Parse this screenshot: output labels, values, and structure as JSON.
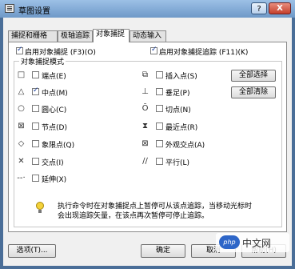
{
  "window": {
    "title": "草图设置",
    "help_label": "?",
    "close_label": "X"
  },
  "tabs": [
    {
      "label": "捕捉和栅格"
    },
    {
      "label": "极轴追踪"
    },
    {
      "label": "对象捕捉"
    },
    {
      "label": "动态输入"
    }
  ],
  "top_options": {
    "enable_snap": {
      "label": "启用对象捕捉 (F3)(O)",
      "checked": true
    },
    "enable_tracking": {
      "label": "启用对象捕捉追踪 (F11)(K)",
      "checked": true
    }
  },
  "group": {
    "title": "对象捕捉模式",
    "select_all": "全部选择",
    "clear_all": "全部清除",
    "left_modes": [
      {
        "label": "端点(E)",
        "checked": false,
        "icon": "square-icon"
      },
      {
        "label": "中点(M)",
        "checked": true,
        "icon": "triangle-icon"
      },
      {
        "label": "圆心(C)",
        "checked": false,
        "icon": "circle-icon"
      },
      {
        "label": "节点(D)",
        "checked": false,
        "icon": "x-box-icon"
      },
      {
        "label": "象限点(Q)",
        "checked": false,
        "icon": "diamond-icon"
      },
      {
        "label": "交点(I)",
        "checked": false,
        "icon": "cross-icon"
      },
      {
        "label": "延伸(X)",
        "checked": false,
        "icon": "extension-icon"
      }
    ],
    "right_modes": [
      {
        "label": "插入点(S)",
        "checked": false,
        "icon": "insert-icon"
      },
      {
        "label": "垂足(P)",
        "checked": false,
        "icon": "perpendicular-icon"
      },
      {
        "label": "切点(N)",
        "checked": false,
        "icon": "tangent-icon"
      },
      {
        "label": "最近点(R)",
        "checked": false,
        "icon": "hourglass-icon"
      },
      {
        "label": "外观交点(A)",
        "checked": false,
        "icon": "apparent-intersection-icon"
      },
      {
        "label": "平行(L)",
        "checked": false,
        "icon": "parallel-icon"
      }
    ],
    "hint_line1": "执行命令时在对象捕捉点上暂停可从该点追踪，当移动光标时",
    "hint_line2": "会出现追踪矢量，在该点再次暂停可停止追踪。"
  },
  "buttons": {
    "options": "选项(T)...",
    "ok": "确定",
    "cancel": "取消",
    "help": "帮助(H)"
  },
  "watermark": {
    "logo": "php",
    "text": "中文网"
  }
}
